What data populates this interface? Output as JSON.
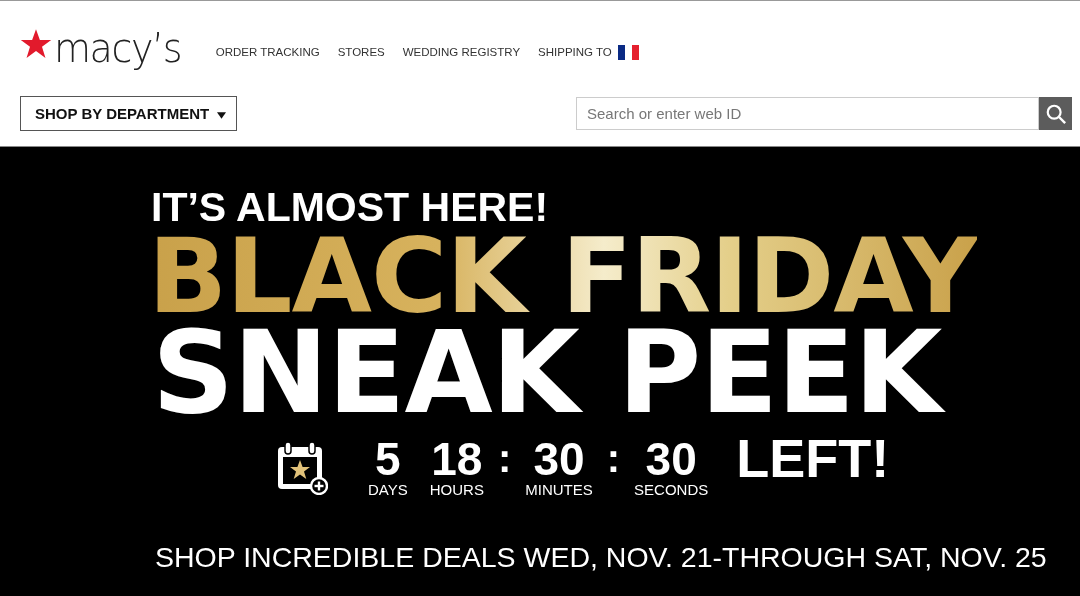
{
  "logo": {
    "wordmark": "macy’s"
  },
  "nav": [
    "ORDER TRACKING",
    "STORES",
    "WEDDING REGISTRY",
    "SHIPPING TO"
  ],
  "department_button": {
    "label": "SHOP BY DEPARTMENT"
  },
  "search": {
    "placeholder": "Search or enter web ID"
  },
  "hero": {
    "kicker": "IT’S ALMOST HERE!",
    "headline": "BLACK FRIDAY",
    "subheadline": "SNEAK PEEK",
    "countdown": [
      {
        "kind": "unit",
        "value": "5",
        "label": "DAYS"
      },
      {
        "kind": "unit",
        "value": "18",
        "label": "HOURS"
      },
      {
        "kind": "separator",
        "text": ":"
      },
      {
        "kind": "unit",
        "value": "30",
        "label": "MINUTES"
      },
      {
        "kind": "separator",
        "text": ":"
      },
      {
        "kind": "unit",
        "value": "30",
        "label": "SECONDS"
      }
    ],
    "countdown_suffix": "LEFT!",
    "tagline": "SHOP INCREDIBLE DEALS WED, NOV. 21-THROUGH SAT, NOV. 25"
  }
}
